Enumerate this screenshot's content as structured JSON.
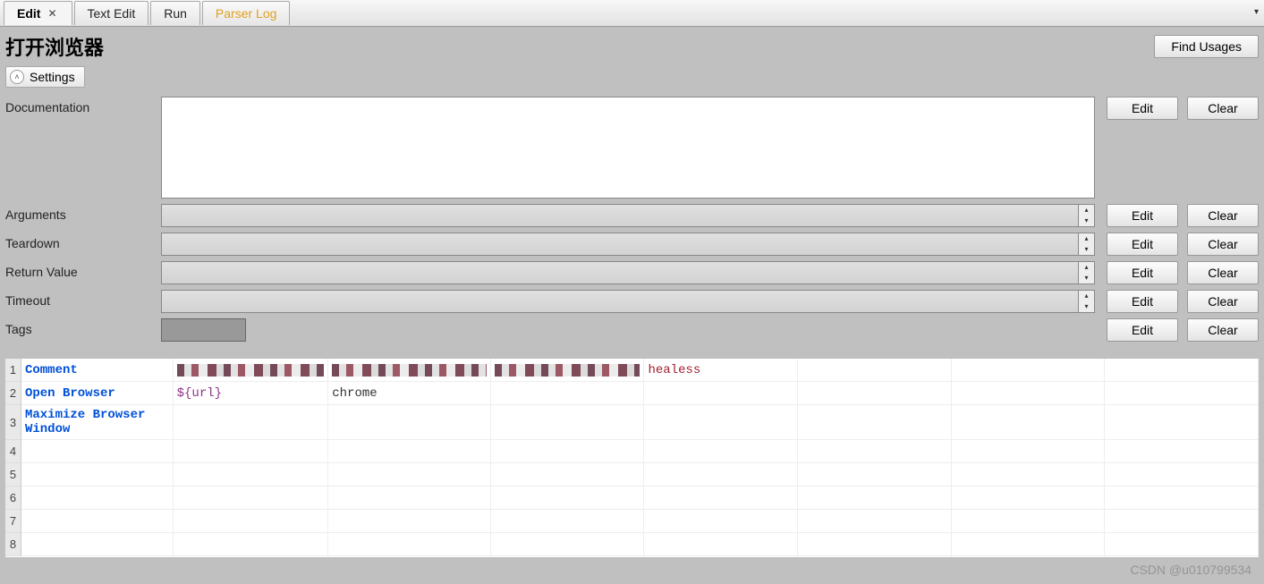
{
  "tabs": [
    {
      "label": "Edit",
      "active": true,
      "closable": true
    },
    {
      "label": "Text Edit",
      "active": false,
      "closable": false
    },
    {
      "label": "Run",
      "active": false,
      "closable": false
    },
    {
      "label": "Parser Log",
      "active": false,
      "closable": false,
      "highlight": true
    }
  ],
  "header": {
    "title": "打开浏览器",
    "find_usages_label": "Find Usages"
  },
  "settings_toggle_label": "Settings",
  "form": {
    "documentation": {
      "label": "Documentation",
      "value": ""
    },
    "arguments": {
      "label": "Arguments",
      "value": ""
    },
    "teardown": {
      "label": "Teardown",
      "value": ""
    },
    "return_value": {
      "label": "Return Value",
      "value": ""
    },
    "timeout": {
      "label": "Timeout",
      "value": ""
    },
    "tags": {
      "label": "Tags",
      "value": ""
    }
  },
  "buttons": {
    "edit": "Edit",
    "clear": "Clear"
  },
  "grid": {
    "rows": [
      {
        "n": 1,
        "keyword": "Comment",
        "c2_type": "pixelated",
        "c3_type": "pixelated",
        "c4_type": "pixelated",
        "c5_type": "red",
        "c5": "healess"
      },
      {
        "n": 2,
        "keyword": "Open Browser",
        "c2_type": "var",
        "c2": "${url}",
        "c3_type": "txt",
        "c3": "chrome"
      },
      {
        "n": 3,
        "keyword": "Maximize Browser Window"
      },
      {
        "n": 4
      },
      {
        "n": 5
      },
      {
        "n": 6
      },
      {
        "n": 7
      },
      {
        "n": 8
      }
    ]
  },
  "watermark": "CSDN @u010799534"
}
